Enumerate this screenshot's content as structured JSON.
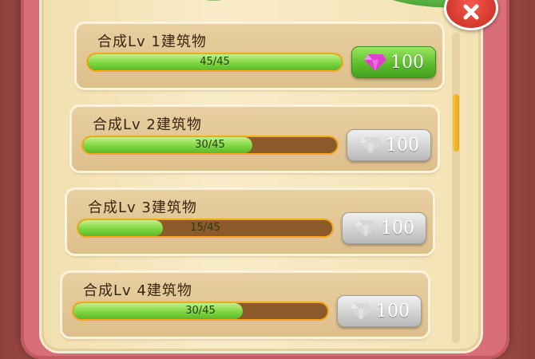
{
  "colors": {
    "gem_active": "#e23fd0",
    "gem_disabled": "#d8d8d8",
    "button_active": "#58bb2b",
    "button_disabled": "#cfcfcf",
    "bar_fill": "#7fd640"
  },
  "tasks": [
    {
      "title": "合成Lv 1建筑物",
      "progress_text": "45/45",
      "progress": 1.0,
      "cost": "100",
      "cost_icon": "gem-icon",
      "claimable": true
    },
    {
      "title": "合成Lv 2建筑物",
      "progress_text": "30/45",
      "progress": 0.667,
      "cost": "100",
      "cost_icon": "gem-icon",
      "claimable": false
    },
    {
      "title": "合成Lv 3建筑物",
      "progress_text": "15/45",
      "progress": 0.333,
      "cost": "100",
      "cost_icon": "gem-icon",
      "claimable": false
    },
    {
      "title": "合成Lv 4建筑物",
      "progress_text": "30/45",
      "progress": 0.667,
      "cost": "100",
      "cost_icon": "gem-icon",
      "claimable": false
    }
  ]
}
